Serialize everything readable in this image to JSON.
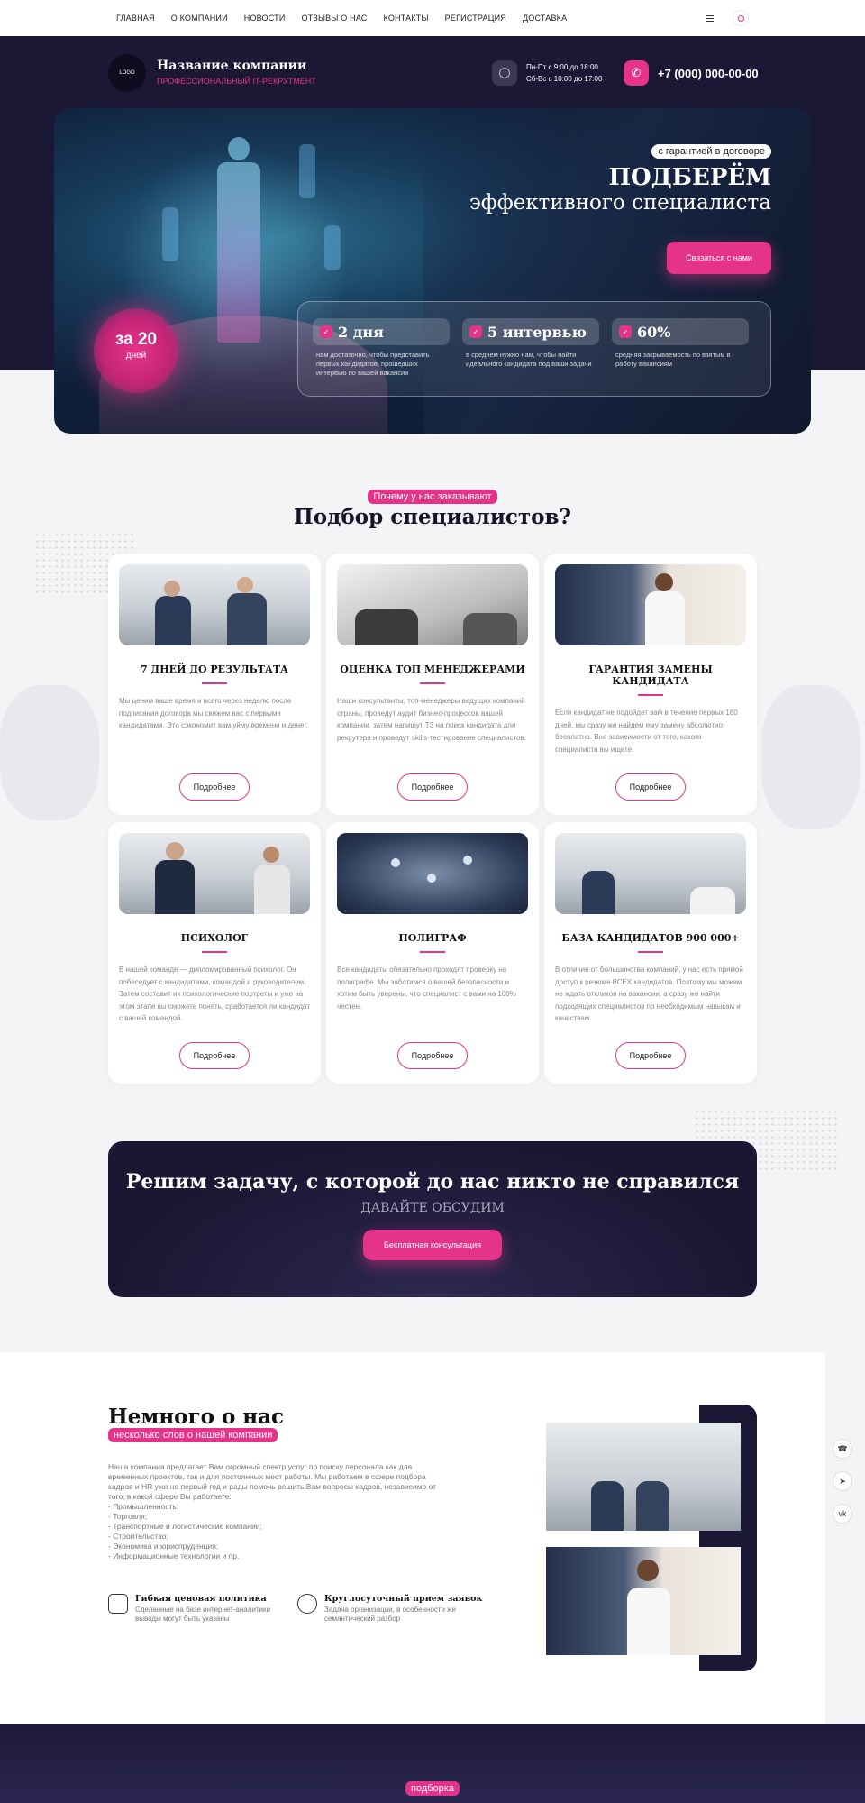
{
  "nav": {
    "links": [
      "ГЛАВНАЯ",
      "О КОМПАНИИ",
      "НОВОСТИ",
      "ОТЗЫВЫ О НАС",
      "КОНТАКТЫ",
      "РЕГИСТРАЦИЯ",
      "ДОСТАВКА"
    ]
  },
  "header": {
    "logo": "LOGO",
    "company_name": "Название компании",
    "company_tagline": "ПРОФЕССИОНАЛЬНЫЙ IT-РЕКРУТМЕНТ",
    "hours_line1": "Пн-Пт с 9:00 до 18:00",
    "hours_line2": "Сб-Вс с 10:00 до 17:00",
    "phone": "+7 (000) 000-00-00"
  },
  "hero": {
    "guarantee": "с гарантией в договоре",
    "title": "ПОДБЕРЁМ",
    "subtitle": "эффективного специалиста",
    "contact_button": "Связаться с нами",
    "badge_big": "за 20",
    "badge_small": "дней",
    "stats": [
      {
        "value": "2 дня",
        "desc": "нам достаточно, чтобы представить первых кандидатов, прошедших интервью по вашей вакансии"
      },
      {
        "value": "5 интервью",
        "desc": "в среднем нужно нам, чтобы найти идеального кандидата под ваши задачи"
      },
      {
        "value": "60%",
        "desc": "средняя закрываемость по взятым в работу вакансиям"
      }
    ]
  },
  "why": {
    "tag": "Почему у нас заказывают",
    "title": "Подбор специалистов?",
    "more_label": "Подробнее",
    "cards": [
      {
        "title": "7 ДНЕЙ ДО РЕЗУЛЬТАТА",
        "text": "Мы ценим ваше время и всего через неделю после подписания договора мы свяжем вас с первыми кандидатами. Это сэкономит вам уйму времени и денег."
      },
      {
        "title": "ОЦЕНКА ТОП МЕНЕДЖЕРАМИ",
        "text": "Наши консультанты, топ-менеджеры ведущих компаний страны, проведут аудит бизнес-процессов вашей компании, затем напишут ТЗ на поиск кандидата для рекрутера и проведут skills-тестирование специалистов."
      },
      {
        "title": "ГАРАНТИЯ ЗАМЕНЫ КАНДИДАТА",
        "text": "Если кандидат не подойдет вам в течение первых 180 дней, мы сразу же найдем ему замену абсолютно бесплатно. Вне зависимости от того, какого специалиста вы ищете."
      },
      {
        "title": "ПСИХОЛОГ",
        "text": "В нашей команде — дипломированный психолог. Он побеседует с кандидатами, командой и руководителем. Затем составит их психологические портреты и уже на этом этапе вы сможете понять, сработается ли кандидат с вашей командой."
      },
      {
        "title": "ПОЛИГРАФ",
        "text": "Все кандидаты обязательно проходят проверку на полиграфе. Мы заботимся о вашей безопасности и хотим быть уверены, что специалист с вами на 100% честен."
      },
      {
        "title": "БАЗА КАНДИДАТОВ 900 000+",
        "text": "В отличие от большинства компаний, у нас есть прямой доступ к резюме ВСЕХ кандидатов. Поэтому мы можем не ждать откликов на вакансии, а сразу же найти подходящих специалистов по необходимым навыкам и качествам."
      }
    ]
  },
  "cta": {
    "title": "Решим задачу, с которой до нас никто не справился",
    "subtitle": "ДАВАЙТЕ ОБСУДИМ",
    "button": "Бесплатная консультация"
  },
  "about": {
    "title": "Немного о нас",
    "subtitle": "несколько слов о нашей компании",
    "text_lines": [
      "Наша компания предлагает Вам огромный спектр услуг по поиску персонала как для",
      "временных проектов, так и для постоянных мест работы. Мы работаем в сфере подбора",
      "кадров и HR уже не первый год и рады помочь решить Вам вопросы кадров, независимо от",
      "того, в какой сфере Вы работаете:",
      "- Промышленность;",
      "- Торговля;",
      "- Транспортные и логистические компании;",
      "- Строительство;",
      "- Экономика и юриспруденция;",
      "- Информационные технологии и пр."
    ],
    "features": [
      {
        "title": "Гибкая ценовая политика",
        "desc": "Сделанные на базе интернет-аналитики выводы могут быть указаны"
      },
      {
        "title": "Круглосуточный прием заявок",
        "desc": "Задача организации, в особенности же семантический разбор"
      }
    ]
  },
  "bottom": {
    "tag": "подборка"
  },
  "colors": {
    "accent": "#e6338a",
    "dark": "#1b1836"
  }
}
